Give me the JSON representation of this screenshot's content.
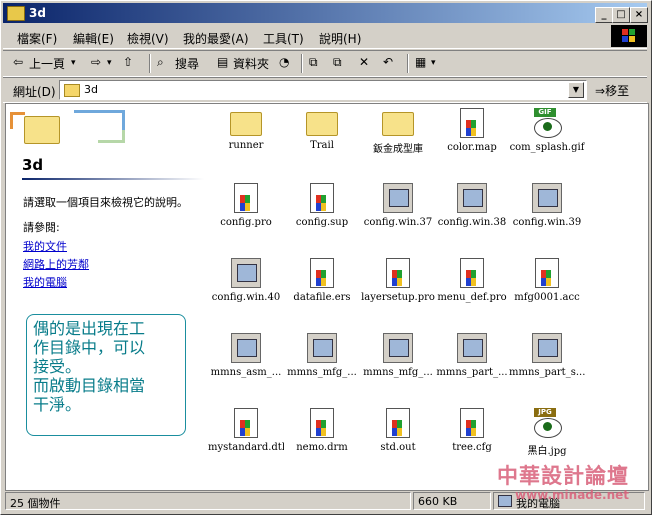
{
  "window": {
    "title": "3d",
    "btn_min": "_",
    "btn_max": "□",
    "btn_close": "×"
  },
  "menu": [
    "檔案(F)",
    "編輯(E)",
    "檢視(V)",
    "我的最愛(A)",
    "工具(T)",
    "說明(H)"
  ],
  "toolbar": {
    "back": "上一頁",
    "search": "搜尋",
    "folders": "資料夾",
    "history": "歷程"
  },
  "address": {
    "label": "網址(D)",
    "value": "3d",
    "go": "移至"
  },
  "left_pane": {
    "folder_title": "3d",
    "description": "請選取一個項目來檢視它的說明。",
    "see_also": "請參閱:",
    "links": [
      "我的文件",
      "網路上的芳鄰",
      "我的電腦"
    ]
  },
  "note": "偶的是出現在工\n作目錄中，可以\n接受。\n而啟動目錄相當\n干淨。",
  "files": [
    {
      "name": "runner",
      "type": "folder"
    },
    {
      "name": "Trail",
      "type": "folder"
    },
    {
      "name": "鈑金成型庫",
      "type": "folder"
    },
    {
      "name": "color.map",
      "type": "doc"
    },
    {
      "name": "com_splash.gif",
      "type": "gif"
    },
    {
      "name": "config.pro",
      "type": "doc"
    },
    {
      "name": "config.sup",
      "type": "doc"
    },
    {
      "name": "config.win.37",
      "type": "win"
    },
    {
      "name": "config.win.38",
      "type": "win"
    },
    {
      "name": "config.win.39",
      "type": "win"
    },
    {
      "name": "config.win.40",
      "type": "win"
    },
    {
      "name": "datafile.ers",
      "type": "doc"
    },
    {
      "name": "layersetup.pro",
      "type": "doc"
    },
    {
      "name": "menu_def.pro",
      "type": "doc"
    },
    {
      "name": "mfg0001.acc",
      "type": "doc"
    },
    {
      "name": "mmns_asm_...",
      "type": "win"
    },
    {
      "name": "mmns_mfg_...",
      "type": "win"
    },
    {
      "name": "mmns_mfg_...",
      "type": "win"
    },
    {
      "name": "mmns_part_...",
      "type": "win"
    },
    {
      "name": "mmns_part_s...",
      "type": "win"
    },
    {
      "name": "mystandard.dtl",
      "type": "doc"
    },
    {
      "name": "nemo.drm",
      "type": "doc"
    },
    {
      "name": "std.out",
      "type": "doc"
    },
    {
      "name": "tree.cfg",
      "type": "doc"
    },
    {
      "name": "黑白.jpg",
      "type": "jpg"
    }
  ],
  "status": {
    "count": "25 個物件",
    "size": "660 KB",
    "location": "我的電腦"
  },
  "watermark": {
    "title": "中華設計論壇",
    "url": "www.minade.net"
  }
}
